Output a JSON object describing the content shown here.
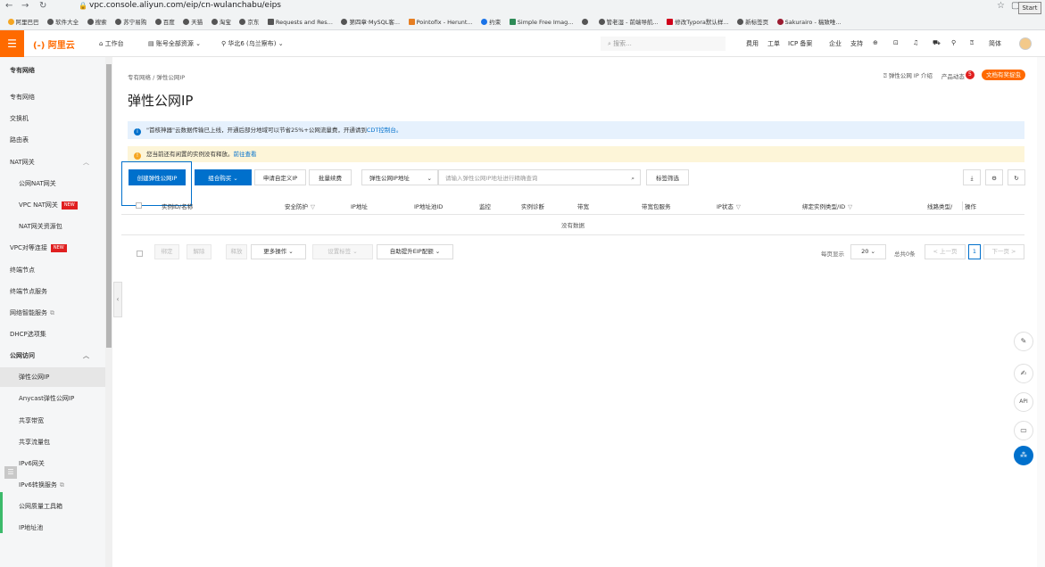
{
  "browser": {
    "url": "vpc.console.aliyun.com/eip/cn-wulanchabu/eips",
    "start_label": "Start",
    "bookmarks": [
      "阿里巴巴",
      "软件大全",
      "搜索",
      "苏宁易购",
      "百度",
      "天猫",
      "淘宝",
      "京东",
      "Requests and Res...",
      "第四章·MySQL客...",
      "Pointofix - Herunt...",
      "约束",
      "Simple Free Imag...",
      "",
      "管老湿 - 前端导航...",
      "修改Typora默认样...",
      "新标签页",
      "Sakurairo - 稿致唯..."
    ]
  },
  "topbar": {
    "logo": "(-) 阿里云",
    "workbench": "工作台",
    "account_scope": "账号全部资源",
    "region": "华北6 (乌兰察布)",
    "search_placeholder": "搜索...",
    "right_items": [
      "费用",
      "工单",
      "ICP 备案",
      "企业",
      "支持"
    ],
    "lang": "简体"
  },
  "sidebar": {
    "items": [
      {
        "label": "专有网络",
        "style": "bold"
      },
      {
        "label": "专有网络"
      },
      {
        "label": "交换机"
      },
      {
        "label": "路由表"
      },
      {
        "label": "NAT网关"
      },
      {
        "label": "公网NAT网关",
        "sub": true
      },
      {
        "label": "VPC NAT网关",
        "sub": true,
        "badge": "NEW"
      },
      {
        "label": "NAT网关资源包",
        "sub": true
      },
      {
        "label": "VPC对等连接",
        "badge": "NEW"
      },
      {
        "label": "终端节点"
      },
      {
        "label": "终端节点服务"
      },
      {
        "label": "网络智能服务"
      },
      {
        "label": "DHCP选项集"
      },
      {
        "label": "公网访问",
        "style": "bold"
      },
      {
        "label": "弹性公网IP",
        "sub": true,
        "active": true
      },
      {
        "label": "Anycast弹性公网IP",
        "sub": true
      },
      {
        "label": "共享带宽",
        "sub": true
      },
      {
        "label": "共享流量包",
        "sub": true
      },
      {
        "label": "IPv6网关",
        "sub": true
      },
      {
        "label": "IPv6转换服务",
        "sub": true
      },
      {
        "label": "公网质量工具箱",
        "sub": true
      },
      {
        "label": "IP地址池",
        "sub": true
      }
    ]
  },
  "main": {
    "breadcrumb": "专有网络  /  弹性公网IP",
    "title": "弹性公网IP",
    "header_links": {
      "intro": "弹性公网 IP 介绍",
      "news": "产品动态",
      "news_count": "5",
      "promo": "文档有奖捉虫"
    },
    "info_text": "\"首核神器\"云数据传输已上线，开通后部分地域可以节省25%+公网流量费，开通请到",
    "info_link": "CDT控制台。",
    "warn_text": "您当前还有闲置的实例没有释放。",
    "warn_link": "前往查看",
    "toolbar": {
      "create": "创建弹性公网IP",
      "combo": "组合购买",
      "apply": "申请自定义IP",
      "batch": "批量续费",
      "filter_select": "弹性公网IP地址",
      "search_placeholder": "请输入弹性公网IP地址进行精确查询",
      "tag_filter": "标签筛选"
    },
    "table": {
      "columns": [
        "实例ID/名称",
        "安全防护",
        "IP地址",
        "IP地址池ID",
        "监控",
        "实例诊断",
        "带宽",
        "带宽包服务",
        "IP状态",
        "绑定实例类型/ID",
        "线路类型/",
        "操作"
      ],
      "empty": "没有数据"
    },
    "bottom": {
      "bind": "绑定",
      "unbind": "解除",
      "release": "释放",
      "more": "更多操作",
      "tags": "设置标签",
      "upgrade": "自助提升EIP配额",
      "page_size_label": "每页显示",
      "page_size": "20",
      "total": "总共0条",
      "prev": "< 上一页",
      "page": "1",
      "next": "下一页 >"
    }
  }
}
